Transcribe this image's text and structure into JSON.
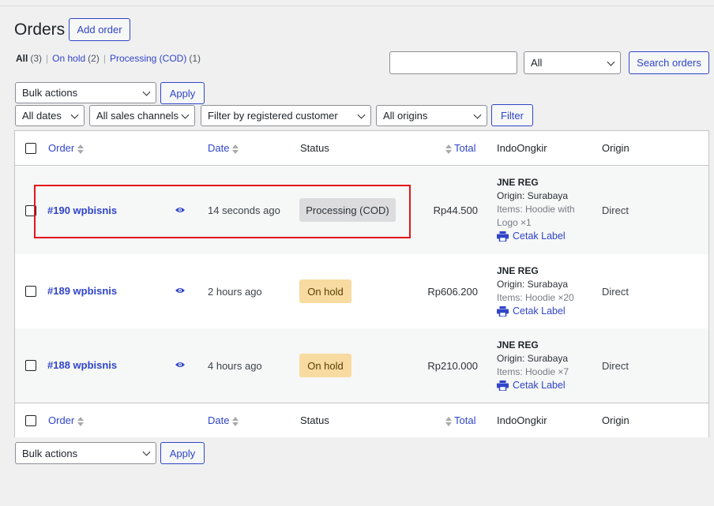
{
  "header": {
    "title": "Orders",
    "add_order_label": "Add order"
  },
  "status_filters": [
    {
      "label": "All",
      "count": "(3)",
      "current": true
    },
    {
      "label": "On hold",
      "count": "(2)"
    },
    {
      "label": "Processing (COD)",
      "count": "(1)"
    }
  ],
  "search": {
    "input_value": "",
    "type_selected": "All",
    "button_label": "Search orders"
  },
  "bulk": {
    "selected": "Bulk actions",
    "apply_label": "Apply"
  },
  "filters": {
    "dates": "All dates",
    "channels": "All sales channels",
    "customer": "Filter by registered customer",
    "origins": "All origins",
    "button_label": "Filter"
  },
  "columns": {
    "order": "Order",
    "date": "Date",
    "status": "Status",
    "total": "Total",
    "indoongkir": "IndoOngkir",
    "origin": "Origin"
  },
  "orders": [
    {
      "title": "#190 wpbisnis",
      "date": "14 seconds ago",
      "status": "Processing (COD)",
      "total": "Rp44.500",
      "courier": "JNE REG",
      "ship_origin": "Origin: Surabaya",
      "items": "Items: Hoodie with Logo ×1",
      "label_link": "Cetak Label",
      "origin": "Direct"
    },
    {
      "title": "#189 wpbisnis",
      "date": "2 hours ago",
      "status": "On hold",
      "total": "Rp606.200",
      "courier": "JNE REG",
      "ship_origin": "Origin: Surabaya",
      "items": "Items: Hoodie ×20",
      "label_link": "Cetak Label",
      "origin": "Direct"
    },
    {
      "title": "#188 wpbisnis",
      "date": "4 hours ago",
      "status": "On hold",
      "total": "Rp210.000",
      "courier": "JNE REG",
      "ship_origin": "Origin: Surabaya",
      "items": "Items: Hoodie ×7",
      "label_link": "Cetak Label",
      "origin": "Direct"
    }
  ],
  "colors": {
    "accent": "#3045c8",
    "highlight": "#e3161b",
    "on_hold_bg": "#f8dba1",
    "processing_bg": "#dcdcde"
  },
  "icons": {
    "preview": "eye-icon",
    "print": "printer-icon",
    "sort": "sort-icon",
    "dropdown": "chevron-down-icon"
  }
}
